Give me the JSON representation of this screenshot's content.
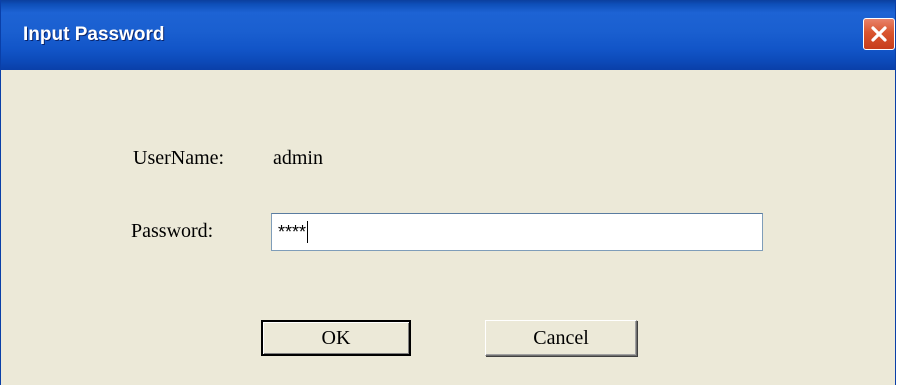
{
  "window": {
    "title": "Input Password",
    "close_icon": "close-icon"
  },
  "form": {
    "username_label": "UserName:",
    "username_value": "admin",
    "password_label": "Password:",
    "password_value": "****"
  },
  "buttons": {
    "ok_label": "OK",
    "cancel_label": "Cancel"
  },
  "colors": {
    "titlebar": "#1a5fd0",
    "close_button": "#d9552f",
    "dialog_background": "#ece9d8"
  }
}
